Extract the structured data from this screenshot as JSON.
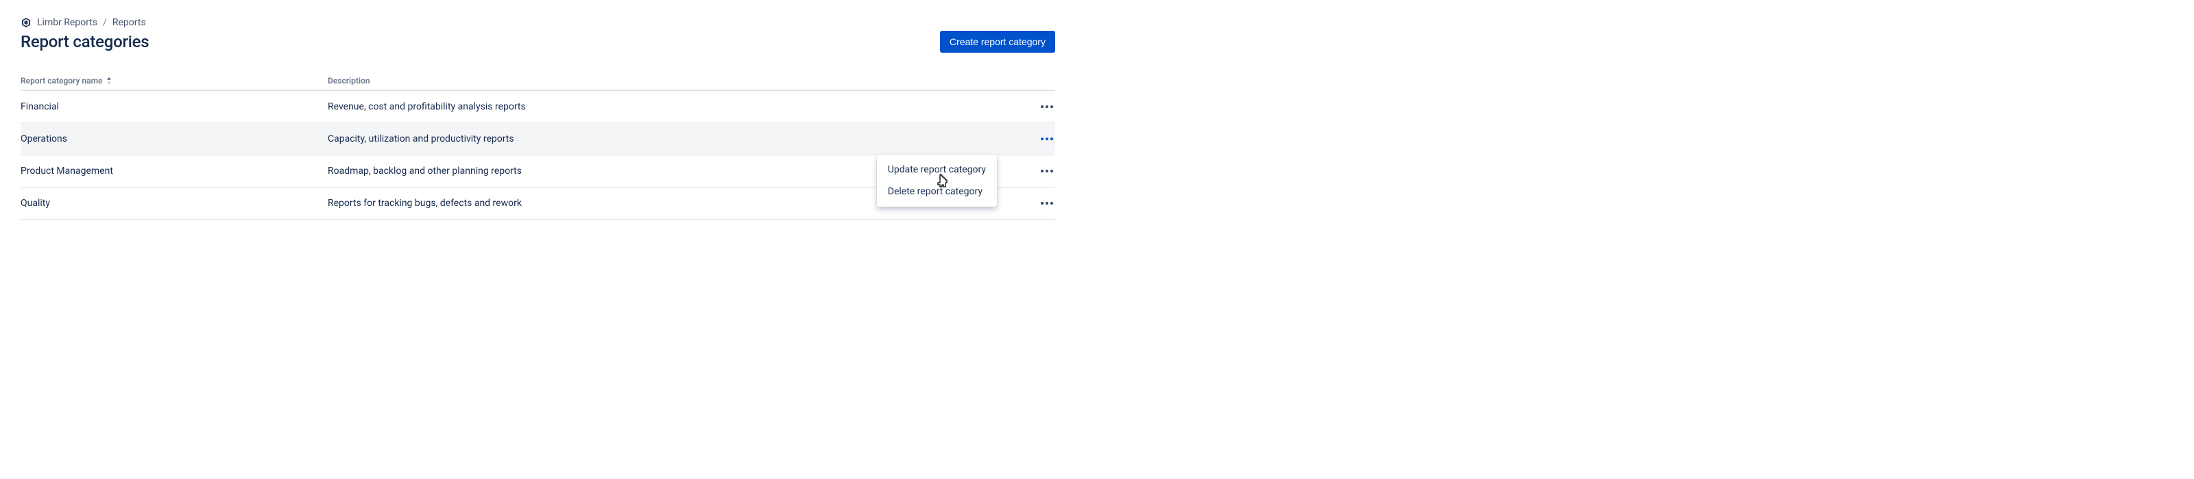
{
  "breadcrumb": {
    "app_name": "Limbr Reports",
    "section": "Reports"
  },
  "page": {
    "title": "Report categories",
    "create_button": "Create report category"
  },
  "table": {
    "columns": {
      "name": "Report category name",
      "description": "Description"
    },
    "rows": [
      {
        "name": "Financial",
        "description": "Revenue, cost and profitability analysis reports"
      },
      {
        "name": "Operations",
        "description": "Capacity, utilization and productivity reports"
      },
      {
        "name": "Product Management",
        "description": "Roadmap, backlog and other planning reports"
      },
      {
        "name": "Quality",
        "description": "Reports for tracking bugs, defects and rework"
      }
    ]
  },
  "dropdown": {
    "update": "Update report category",
    "delete": "Delete report category"
  }
}
